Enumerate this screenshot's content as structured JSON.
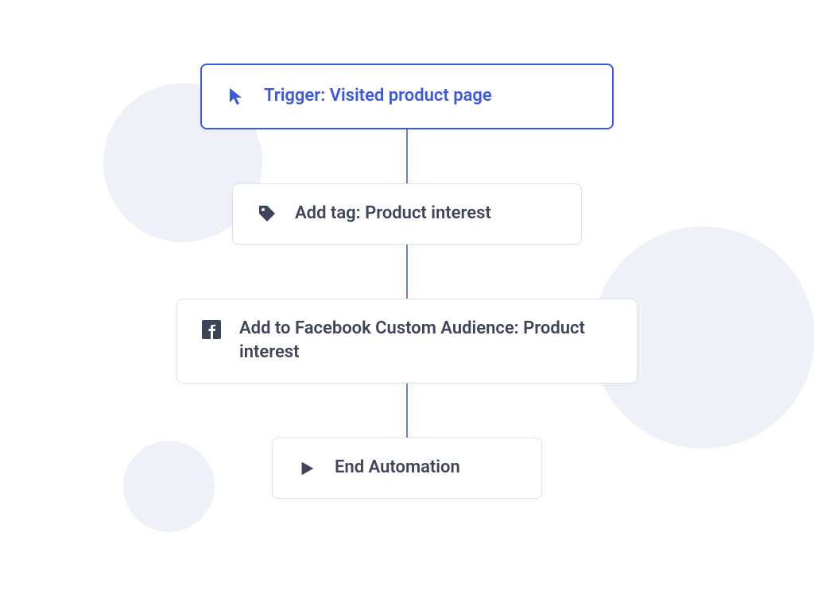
{
  "flow": {
    "nodes": [
      {
        "id": "trigger",
        "icon": "cursor",
        "label": "Trigger: Visited product page",
        "type": "trigger"
      },
      {
        "id": "tag",
        "icon": "tag",
        "label": "Add tag: Product interest",
        "type": "action"
      },
      {
        "id": "facebook",
        "icon": "facebook",
        "label": "Add to Facebook Custom Audience: Product interest",
        "type": "action-wide"
      },
      {
        "id": "end",
        "icon": "play",
        "label": "End Automation",
        "type": "end"
      }
    ]
  },
  "colors": {
    "primary": "#3c5ae0",
    "text": "#3e4558",
    "border": "#dbe3ef",
    "bgCircle": "#eef1f8",
    "connector": "#6b7fd6"
  }
}
